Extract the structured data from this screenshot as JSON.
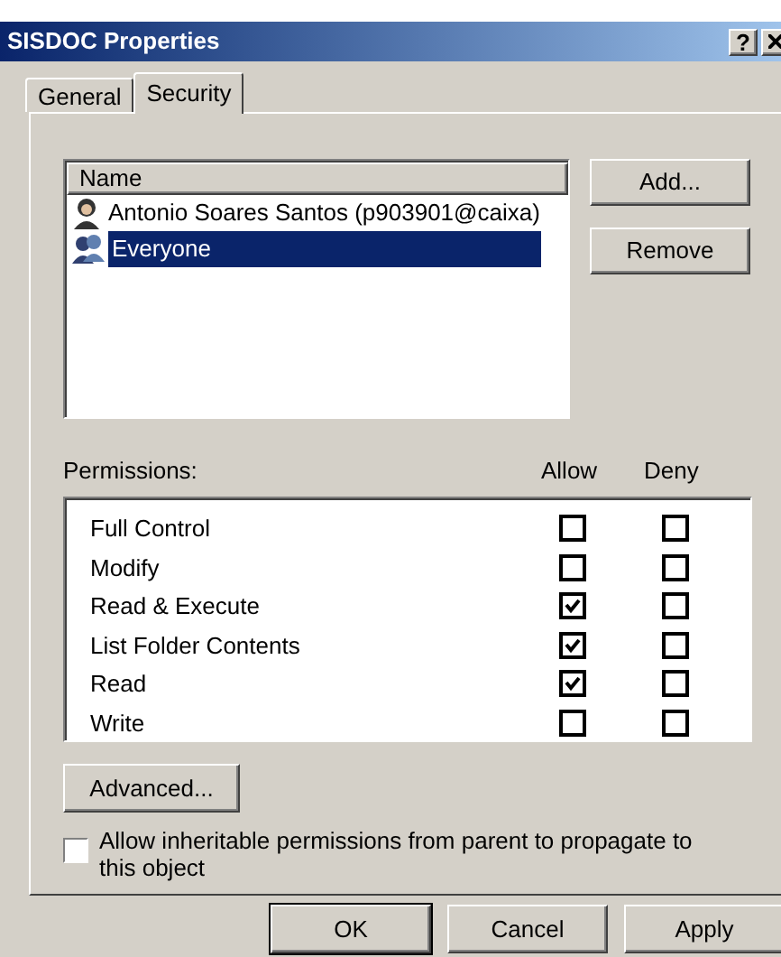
{
  "window": {
    "title": "SISDOC Properties",
    "help": "?"
  },
  "tabs": [
    {
      "label": "General",
      "selected": false
    },
    {
      "label": "Security",
      "selected": true
    }
  ],
  "names": {
    "header": "Name",
    "items": [
      {
        "label": "Antonio Soares Santos (p903901@caixa)",
        "kind": "user",
        "selected": false
      },
      {
        "label": "Everyone",
        "kind": "group",
        "selected": true
      }
    ]
  },
  "side_buttons": [
    "Add...",
    "Remove"
  ],
  "permissions": {
    "label": "Permissions:",
    "allow_header": "Allow",
    "deny_header": "Deny",
    "rows": [
      {
        "label": "Full Control",
        "allow": false,
        "deny": false
      },
      {
        "label": "Modify",
        "allow": false,
        "deny": false
      },
      {
        "label": "Read & Execute",
        "allow": true,
        "deny": false
      },
      {
        "label": "List Folder Contents",
        "allow": true,
        "deny": false
      },
      {
        "label": "Read",
        "allow": true,
        "deny": false
      },
      {
        "label": "Write",
        "allow": false,
        "deny": false
      }
    ]
  },
  "advanced_button": "Advanced...",
  "inherit": {
    "label": "Allow inheritable permissions from parent to propagate to this object",
    "checked": false
  },
  "buttons": [
    "OK",
    "Cancel",
    "Apply"
  ]
}
